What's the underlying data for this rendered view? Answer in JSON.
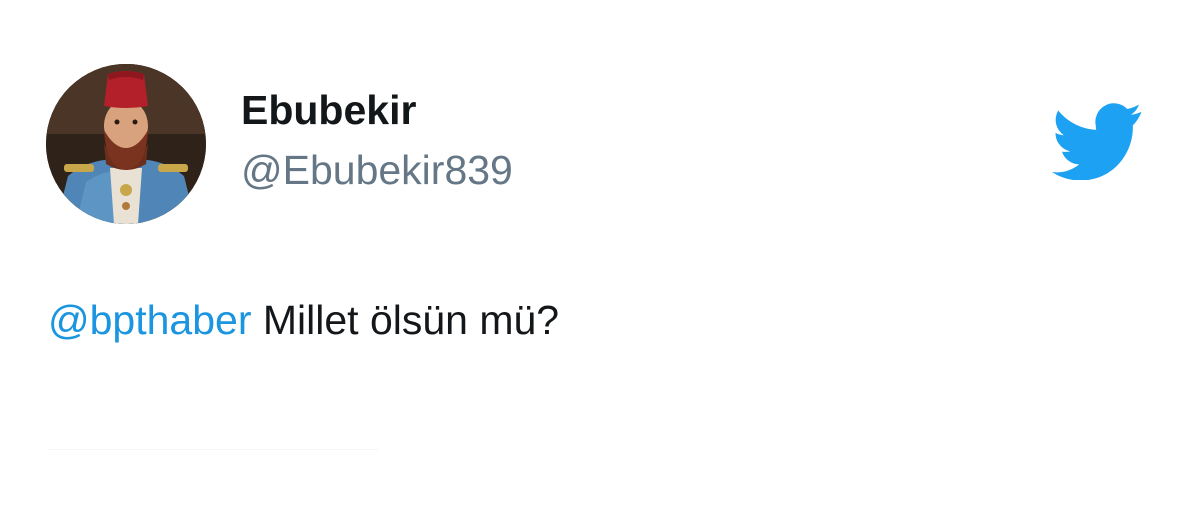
{
  "tweet": {
    "author": {
      "display_name": "Ebubekir",
      "handle": "@Ebubekir839",
      "avatar_icon": "profile-avatar-portrait"
    },
    "text": {
      "mention": "@bpthaber",
      "body": " Millet ölsün mü?"
    },
    "brand_icon": "twitter-bird-icon"
  },
  "colors": {
    "name_text": "#14171a",
    "handle_text": "#657786",
    "mention_link": "#1b95e0",
    "twitter_blue": "#1da1f2",
    "background": "#ffffff"
  }
}
